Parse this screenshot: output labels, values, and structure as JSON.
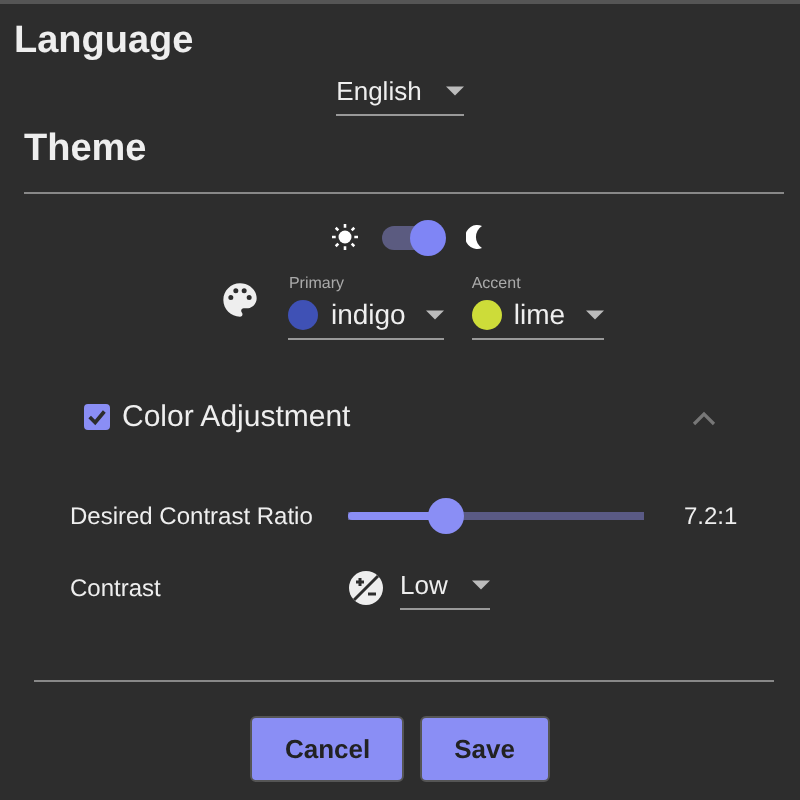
{
  "language": {
    "heading": "Language",
    "value": "English"
  },
  "theme": {
    "heading": "Theme",
    "dark_mode": true,
    "colors": [
      {
        "label": "Primary",
        "value": "indigo",
        "color": "#3f51b5"
      },
      {
        "label": "Accent",
        "value": "lime",
        "color": "#cddc39"
      }
    ],
    "color_adjustment": {
      "label": "Color Adjustment",
      "checked": true,
      "expanded": true,
      "contrast_ratio": {
        "label": "Desired Contrast Ratio",
        "level": 0.33,
        "reading": "7.2:1"
      },
      "contrast": {
        "label": "Contrast",
        "value": "Low"
      }
    }
  },
  "buttons": [
    {
      "label": "Cancel"
    },
    {
      "label": "Save"
    }
  ]
}
